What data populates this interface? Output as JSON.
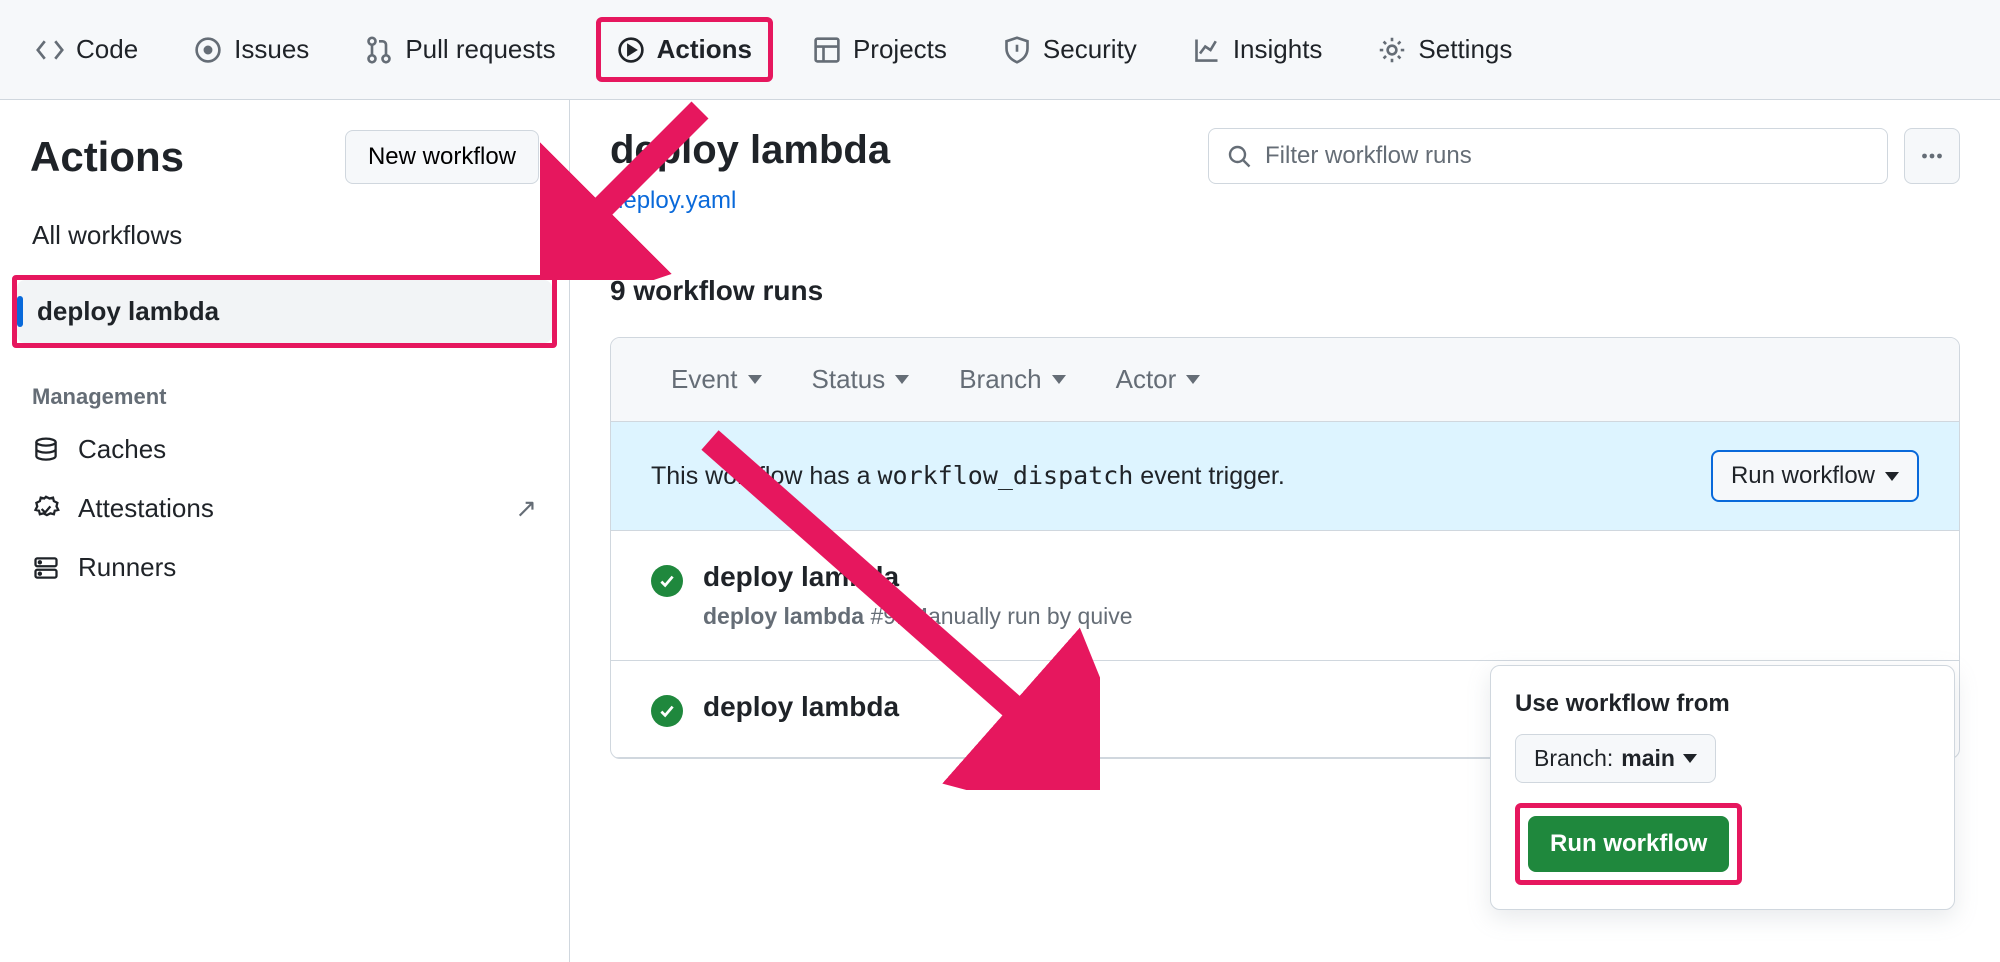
{
  "nav": {
    "code": "Code",
    "issues": "Issues",
    "pull_requests": "Pull requests",
    "actions": "Actions",
    "projects": "Projects",
    "security": "Security",
    "insights": "Insights",
    "settings": "Settings"
  },
  "sidebar": {
    "title": "Actions",
    "new_workflow": "New workflow",
    "all_workflows": "All workflows",
    "selected_wf": "deploy lambda",
    "management_label": "Management",
    "caches": "Caches",
    "attestations": "Attestations",
    "runners": "Runners"
  },
  "main": {
    "wf_title": "deploy lambda",
    "wf_file": "deploy.yaml",
    "filter_placeholder": "Filter workflow runs",
    "runs_count": "9 workflow runs",
    "filters": {
      "event": "Event",
      "status": "Status",
      "branch": "Branch",
      "actor": "Actor"
    },
    "dispatch_text_pre": "This workflow has a ",
    "dispatch_code": "workflow_dispatch",
    "dispatch_text_post": " event trigger.",
    "run_workflow_btn": "Run workflow",
    "runs": [
      {
        "title": "deploy lambda",
        "sub_wf": "deploy lambda",
        "sub_num": "#9",
        "sub_rest": ": Manually run by quive"
      },
      {
        "title": "deploy lambda"
      }
    ]
  },
  "popover": {
    "label": "Use workflow from",
    "branch_prefix": "Branch: ",
    "branch_value": "main",
    "run_label": "Run workflow"
  }
}
